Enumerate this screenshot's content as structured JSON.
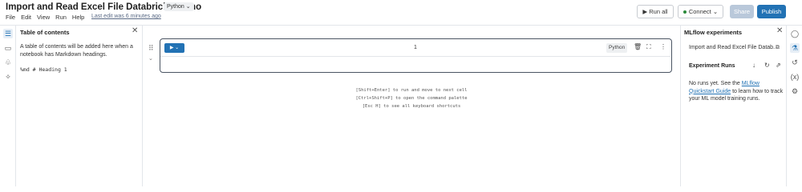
{
  "header": {
    "title": "Import and Read Excel File Databricks Demo",
    "language": "Python",
    "menu": [
      "File",
      "Edit",
      "View",
      "Run",
      "Help"
    ],
    "last_edit": "Last edit was 6 minutes ago",
    "run_all": "Run all",
    "connect": "Connect",
    "share": "Share",
    "publish": "Publish"
  },
  "toc": {
    "title": "Table of contents",
    "description": "A table of contents will be added here when a notebook has Markdown headings.",
    "example": "%md # Heading 1"
  },
  "cell": {
    "number": "1",
    "language": "Python"
  },
  "hints": [
    "[Shift+Enter] to run and move to next cell",
    "[Ctrl+Shift+P] to open the command palette",
    "[Esc H] to see all keyboard shortcuts"
  ],
  "mlflow": {
    "title": "MLflow experiments",
    "experiment_name": "Import and Read Excel File Datab...",
    "runs_label": "Experiment Runs",
    "no_runs_pre": "No runs yet. See the ",
    "link_text": "MLflow Quickstart Guide",
    "no_runs_post": " to learn how to track your ML model training runs."
  },
  "colors": {
    "accent": "#2272b4",
    "share_disabled": "#b9c8da",
    "connected": "#2a8a3a"
  }
}
